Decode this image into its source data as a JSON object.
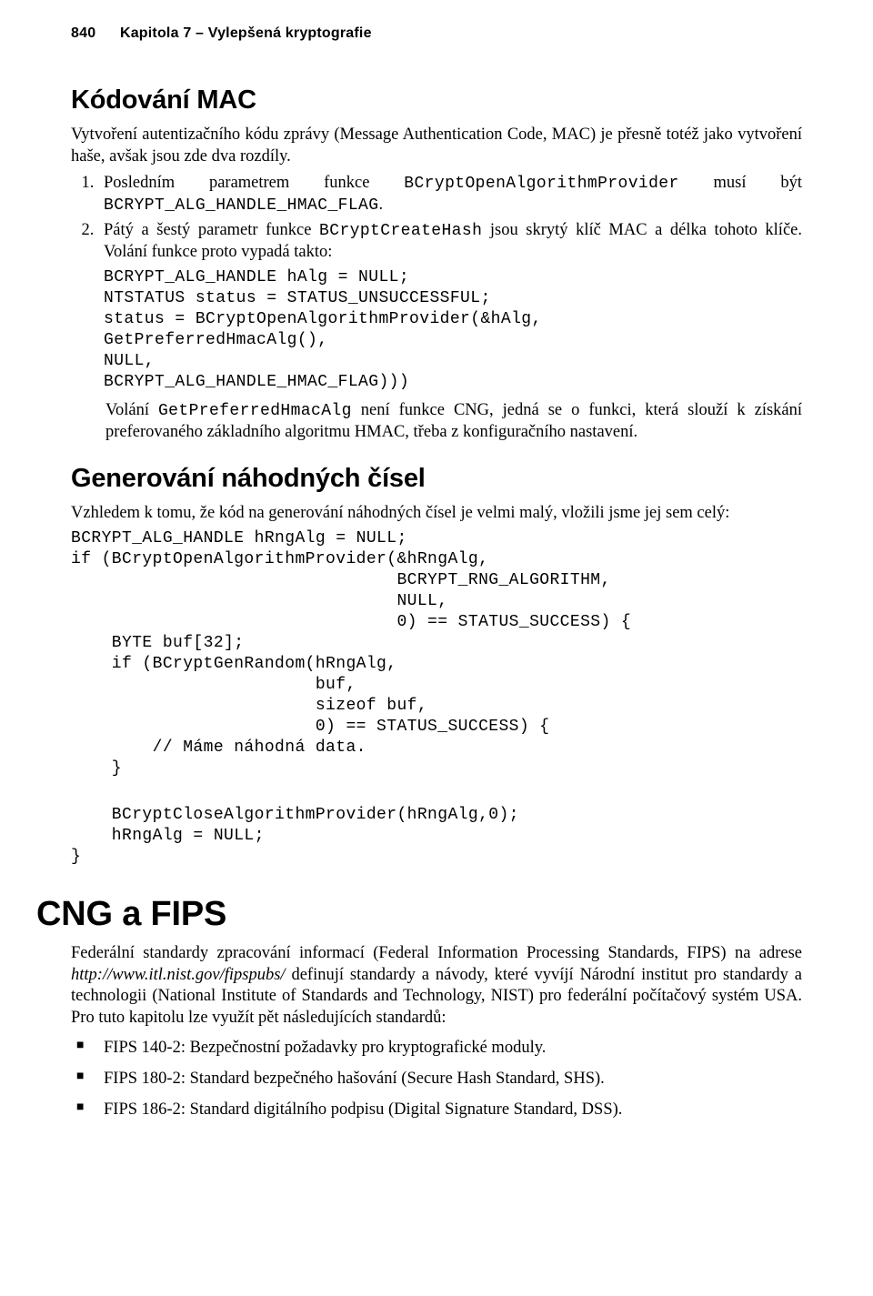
{
  "header": {
    "page_number": "840",
    "running_title": "Kapitola 7 – Vylepšená kryptografie"
  },
  "section1": {
    "title": "Kódování MAC",
    "intro": "Vytvoření autentizačního kódu zprávy (Message Authentication Code, MAC) je přesně totéž jako vytvoření haše, avšak jsou zde dva rozdíly.",
    "li1a": "Posledním parametrem funkce ",
    "li1b": "BCryptOpenAlgorithmProvider",
    "li1c": " musí být ",
    "li1d": "BCRYPT_ALG_HANDLE_HMAC_FLAG",
    "li1e": ".",
    "li2a": "Pátý a šestý parametr funkce ",
    "li2b": "BCryptCreateHash",
    "li2c": " jsou skrytý klíč MAC a délka tohoto klíče. Volání funkce proto vypadá takto:",
    "code1": "BCRYPT_ALG_HANDLE hAlg = NULL;\nNTSTATUS status = STATUS_UNSUCCESSFUL;\nstatus = BCryptOpenAlgorithmProvider(&hAlg,\nGetPreferredHmacAlg(),\nNULL,\nBCRYPT_ALG_HANDLE_HMAC_FLAG)))",
    "outro_a": "Volání ",
    "outro_b": "GetPreferredHmacAlg",
    "outro_c": " není funkce CNG, jedná se o funkci, která slouží k získání preferovaného základního algoritmu HMAC, třeba z konfiguračního nastavení."
  },
  "section2": {
    "title": "Generování náhodných čísel",
    "intro": "Vzhledem k tomu, že kód na generování náhodných čísel je velmi malý, vložili jsme jej sem celý:",
    "code1": "BCRYPT_ALG_HANDLE hRngAlg = NULL;\nif (BCryptOpenAlgorithmProvider(&hRngAlg,\n                                BCRYPT_RNG_ALGORITHM,\n                                NULL,\n                                0) == STATUS_SUCCESS) {\n    BYTE buf[32];\n    if (BCryptGenRandom(hRngAlg,\n                        buf,\n                        sizeof buf,\n                        0) == STATUS_SUCCESS) {\n        // Máme náhodná data.\n    }",
    "code2": "    BCryptCloseAlgorithmProvider(hRngAlg,0);\n    hRngAlg = NULL;\n}"
  },
  "section3": {
    "title": "CNG a FIPS",
    "p1_a": "Federální standardy zpracování informací (Federal Information Processing Standards, FIPS) na adrese ",
    "p1_url": "http://www.itl.nist.gov/fipspubs/",
    "p1_b": " definují standardy a návody, které vyvíjí Národní institut pro standardy a technologii (National Institute of Standards and Technology, NIST) pro federální počítačový systém USA. Pro tuto kapitolu lze využít pět následujících standardů:",
    "bullets": [
      "FIPS 140-2: Bezpečnostní požadavky pro kryptografické moduly.",
      "FIPS 180-2: Standard bezpečného hašování (Secure Hash Standard, SHS).",
      "FIPS 186-2: Standard digitálního podpisu (Digital Signature Standard, DSS)."
    ]
  }
}
